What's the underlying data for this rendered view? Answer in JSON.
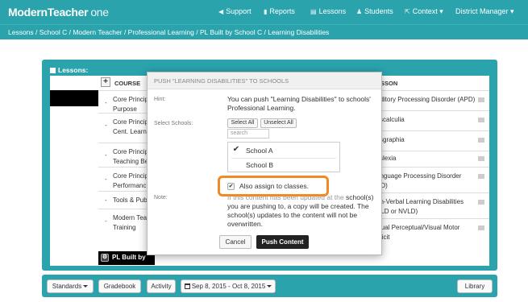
{
  "topbar": {
    "logo_main": "ModernTeacher",
    "logo_suffix": "one",
    "nav": [
      {
        "label": "Support",
        "icon": "bullhorn-icon"
      },
      {
        "label": "Reports",
        "icon": "bar-chart-icon"
      },
      {
        "label": "Lessons",
        "icon": "book-icon"
      },
      {
        "label": "Students",
        "icon": "user-icon"
      },
      {
        "label": "Context",
        "icon": "share-icon"
      },
      {
        "label": "District Manager",
        "icon": "caret-down-icon"
      }
    ]
  },
  "breadcrumb": "Lessons / School C / Modern Teacher / Professional Learning / PL Built by School C / Learning Disabilities",
  "panel": {
    "title": "Lessons:",
    "course_header": "COURSE",
    "lesson_header": "ESSON",
    "courses": [
      "Core Princip\nPurpose",
      "Core Princip\nCent. Learn",
      "Core Princip\nTeaching Be",
      "Core Princip\nPerformanc",
      "Tools & Pub",
      "Modern Tea\nTraining"
    ],
    "pl_row": "PL Built by",
    "lessons": [
      "uditory Processing Disorder (APD)",
      "yscalculia",
      "ysgraphia",
      "yslexia",
      "anguage Processing Disorder\nPD)",
      "on-Verbal Learning Disabilities\nVLD or NVLD)",
      "isual Perceptual/Visual Motor\neficit"
    ]
  },
  "modal": {
    "title": "PUSH \"LEARNING DISABILITIES\" TO SCHOOLS",
    "hint_label": "Hint:",
    "hint_text": "You can push \"Learning Disabilities\" to schools' Professional Learning.",
    "schools_label": "Select Schools:",
    "select_all": "Select All",
    "unselect_all": "Unselect All",
    "search_placeholder": "search",
    "schools": [
      {
        "name": "School A",
        "checked": true
      },
      {
        "name": "School B",
        "checked": false
      }
    ],
    "assign_label": "Also assign to classes.",
    "assign_checked": true,
    "note_label": "Note:",
    "note_faded": "If this content has been updated at the",
    "note_text": "school(s) you are pushing to, a copy will be created. The school(s) updates to the content will not be overwritten.",
    "cancel": "Cancel",
    "push": "Push Content"
  },
  "toolbar": {
    "standards": "Standards",
    "gradebook": "Gradebook",
    "activity": "Activity",
    "date_range": "Sep 8, 2015 - Oct 8, 2015",
    "library": "Library"
  },
  "colors": {
    "teal": "#2aa3ad",
    "highlight": "#f08a24",
    "primary_button": "#222222"
  }
}
